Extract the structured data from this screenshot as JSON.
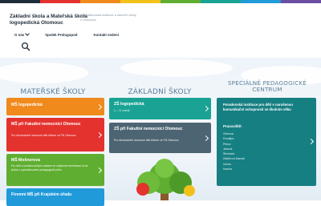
{
  "colors": {
    "topbar": [
      "#1f2d3a",
      "#e4322f",
      "#f08a1c",
      "#f2c21b",
      "#5fae31",
      "#1aa394",
      "#209ad9",
      "#6a4fa3"
    ],
    "orange": "#f08a1c",
    "red": "#e4322f",
    "green": "#5fae31",
    "blue": "#209ad9",
    "teal": "#1aa394",
    "slate": "#4d6473",
    "dark_teal": "#167f82",
    "title_blue": "#5b7f98"
  },
  "header": {
    "title": "Základní škola a Mateřská škola logopedická Olomouc",
    "subtitle": "Specializovaná instituce a zároveň školy v Olomouci"
  },
  "nav": {
    "items": [
      {
        "label": "O nás",
        "has_dropdown": true
      },
      {
        "label": "Spolek Prologopod",
        "has_dropdown": false
      },
      {
        "label": "Kontakt vedení",
        "has_dropdown": false
      }
    ],
    "search_icon": "search-icon"
  },
  "columns": {
    "ms": {
      "title": "Mateřské školy",
      "cards": [
        {
          "title": "MŠ logopedická",
          "desc": ""
        },
        {
          "title": "MŠ při Fakultní nemocnici Olomouc",
          "desc": "Pro dlouhodobě nemocné děti léčené ve FN Olomouc"
        },
        {
          "title": "MŠ Mošnerova",
          "desc": "Pro děti s kombinovanými vadami ve vzájemné kombinaci ať se jedná o specializované pedagogické péče"
        },
        {
          "title": "Firemní MŠ při Krajském úřadu",
          "desc": ""
        }
      ]
    },
    "zs": {
      "title": "Základní školy",
      "cards": [
        {
          "title": "ZŠ logopedická",
          "desc": "1. – 9. ročník"
        },
        {
          "title": "ZŠ při Fakultní nemocnici Olomouc",
          "desc": "Pro dlouhodobě nemocné děti léčené ve FN Olomouc"
        }
      ]
    },
    "spc": {
      "title": "Speciálně pedagogické centrum",
      "desc": "Poradenská instituce pro děti s narušenou komunikační schopností ve školním věku",
      "workplaces_label": "Pracoviště:",
      "workplaces": [
        "Olomouc",
        "Prostějov",
        "Přerov",
        "Jeseník",
        "Šternberk",
        "Zábřeh na Moravě",
        "Uničov",
        "Hranice"
      ]
    }
  }
}
